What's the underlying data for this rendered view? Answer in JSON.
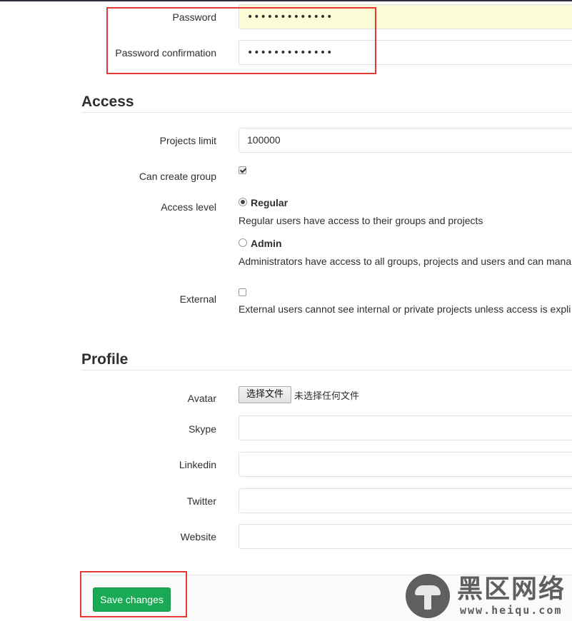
{
  "account": {
    "password_label": "Password",
    "password_value": "•••••••••••••",
    "password_confirmation_label": "Password confirmation",
    "password_confirmation_value": "•••••••••••••"
  },
  "access": {
    "title": "Access",
    "projects_limit_label": "Projects limit",
    "projects_limit_value": "100000",
    "can_create_group_label": "Can create group",
    "can_create_group_checked": true,
    "access_level_label": "Access level",
    "options": [
      {
        "label": "Regular",
        "help": "Regular users have access to their groups and projects",
        "selected": true
      },
      {
        "label": "Admin",
        "help": "Administrators have access to all groups, projects and users and can mana",
        "selected": false
      }
    ],
    "external_label": "External",
    "external_checked": false,
    "external_help": "External users cannot see internal or private projects unless access is expli"
  },
  "profile": {
    "title": "Profile",
    "avatar_label": "Avatar",
    "avatar_button": "选择文件",
    "avatar_status": "未选择任何文件",
    "skype_label": "Skype",
    "skype_value": "",
    "linkedin_label": "Linkedin",
    "linkedin_value": "",
    "twitter_label": "Twitter",
    "twitter_value": "",
    "website_label": "Website",
    "website_value": ""
  },
  "footer": {
    "save_label": "Save changes"
  },
  "watermark": {
    "title": "黑区网络",
    "url": "www.heiqu.com"
  },
  "colors": {
    "save_button": "#1aaa55",
    "annotation_red": "#e53935",
    "autofill_yellow": "#fafdd6"
  }
}
